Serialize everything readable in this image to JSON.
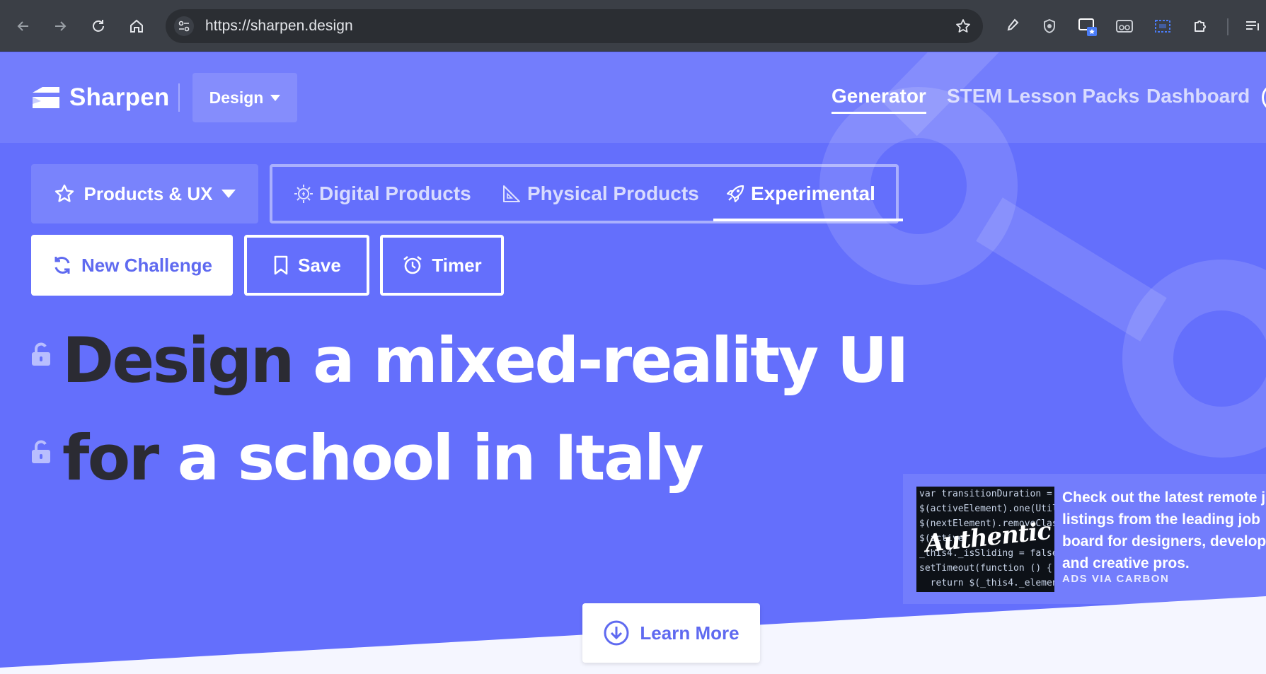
{
  "browser": {
    "url": "https://sharpen.design",
    "back_icon": "arrow-left-icon",
    "forward_icon": "arrow-right-icon",
    "reload_icon": "reload-icon",
    "home_icon": "home-icon"
  },
  "header": {
    "brand": "Sharpen",
    "category_dropdown": "Design",
    "nav": [
      {
        "label": "Generator",
        "active": true
      },
      {
        "label": "STEM Lesson Packs",
        "active": false
      },
      {
        "label": "Dashboard",
        "active": false
      }
    ]
  },
  "filters": {
    "products_dropdown": "Products & UX",
    "tabs": [
      {
        "label": "Digital Products",
        "icon": "lightbulb-icon",
        "active": false
      },
      {
        "label": "Physical Products",
        "icon": "set-square-icon",
        "active": false
      },
      {
        "label": "Experimental",
        "icon": "rocket-icon",
        "active": true
      }
    ]
  },
  "actions": {
    "new_challenge": "New Challenge",
    "save": "Save",
    "timer": "Timer"
  },
  "challenge": {
    "line1_keyword": "Design",
    "line1_rest": "a mixed-reality UI",
    "line2_keyword": "for",
    "line2_rest": "a school in Italy"
  },
  "ad": {
    "image_code": "var transitionDuration = Util\n$(activeElement).one(Util.TRA\n$(nextElement).removeClass\n$(active\n_this4._isSliding = false\nsetTimeout(function () {\n  return $(_this4._element",
    "image_brand": "Authentic",
    "lines": [
      "Check out the latest remote jo",
      "listings from the leading job",
      "board for designers, develope",
      "and creative pros."
    ],
    "via": "ADS VIA CARBON"
  },
  "learn_more": "Learn More",
  "colors": {
    "background": "#646ffc",
    "accent_text": "#5f6af0",
    "dark_keyword": "#2b2b33"
  }
}
